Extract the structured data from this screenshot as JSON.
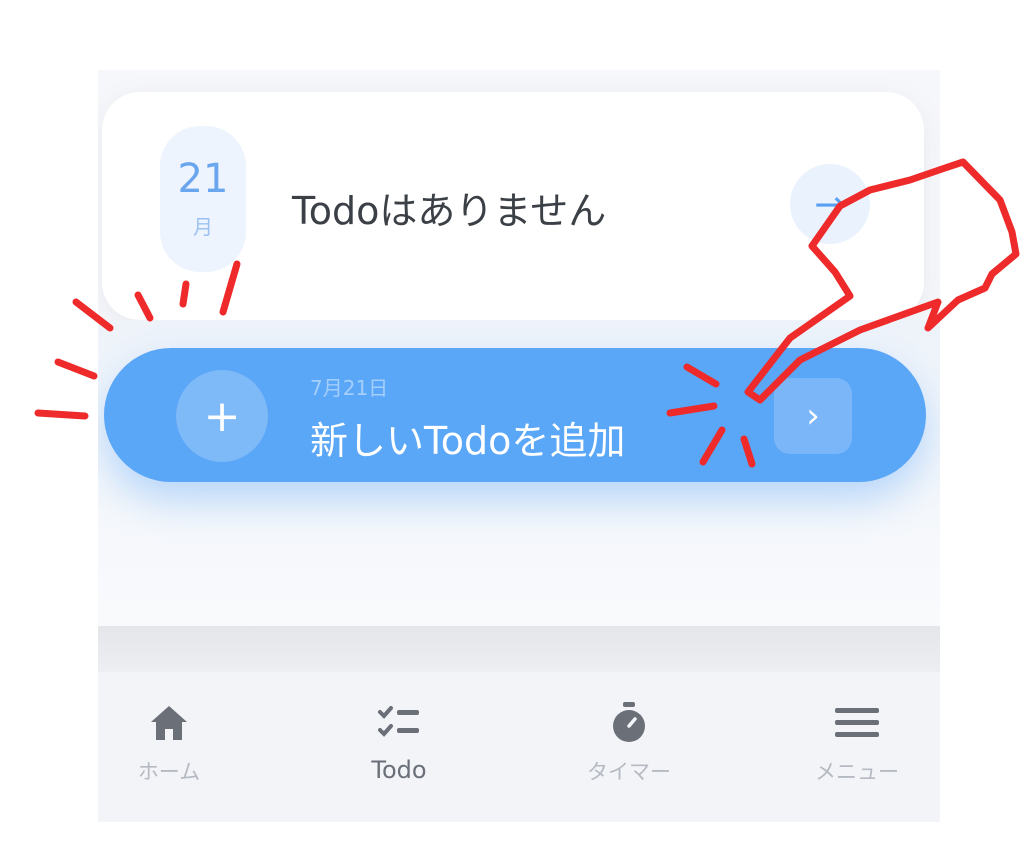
{
  "today": {
    "day": "21",
    "weekday": "月",
    "empty_message": "Todoはありません",
    "arrow_glyph": "→"
  },
  "add_button": {
    "date": "7月21日",
    "label": "新しいTodoを追加",
    "plus_glyph": "+",
    "chevron_glyph": "›"
  },
  "tabs": [
    {
      "label": "ホーム",
      "icon": "home-icon"
    },
    {
      "label": "Todo",
      "icon": "checklist-icon",
      "active": true
    },
    {
      "label": "タイマー",
      "icon": "stopwatch-icon"
    },
    {
      "label": "メニュー",
      "icon": "hamburger-menu-icon"
    }
  ],
  "colors": {
    "accent": "#5aa6f7",
    "annotation": "#ee2a2a",
    "tab_icon": "#6a6f78"
  }
}
